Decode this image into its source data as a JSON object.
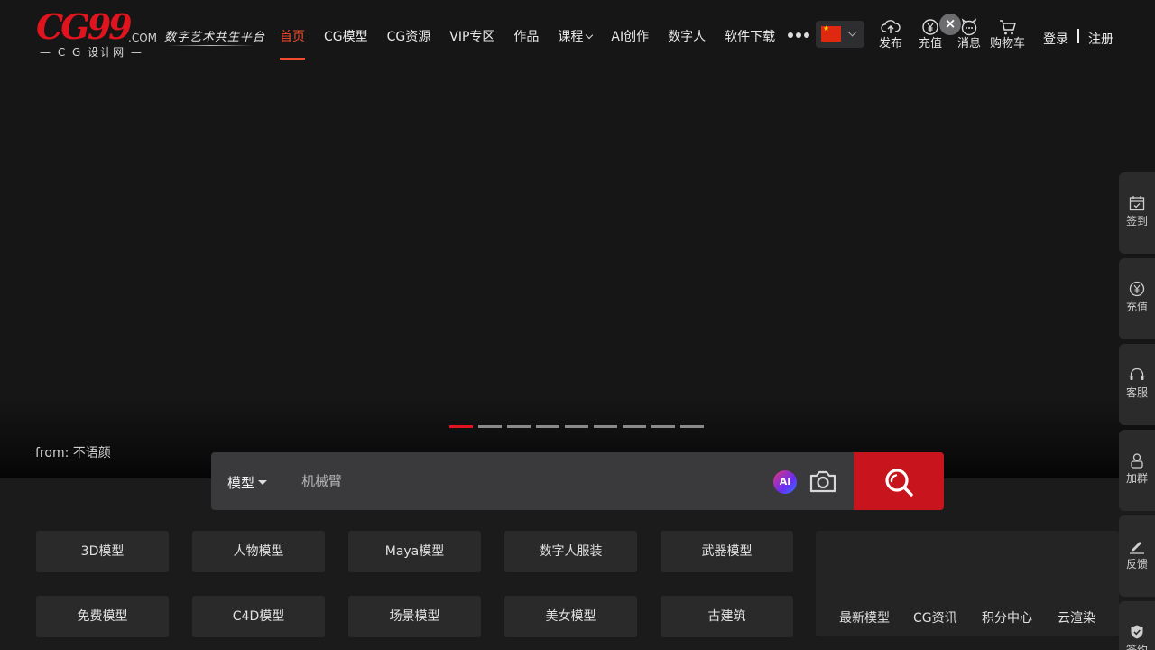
{
  "header": {
    "logo_main": "CG99",
    "logo_com": ".COM",
    "logo_sub": "— C G 设计网 —",
    "slogan": "数字艺术共生平台",
    "nav": [
      {
        "label": "首页",
        "active": true
      },
      {
        "label": "CG模型"
      },
      {
        "label": "CG资源"
      },
      {
        "label": "VIP专区"
      },
      {
        "label": "作品"
      },
      {
        "label": "课程"
      },
      {
        "label": "AI创作"
      },
      {
        "label": "数字人"
      },
      {
        "label": "软件下载"
      }
    ],
    "icons": {
      "publish": "发布",
      "recharge": "充值",
      "messages": "消息",
      "cart": "购物车"
    },
    "close_badge": "×",
    "login": "登录",
    "register": "注册"
  },
  "hero": {
    "credit": "from: 不语颜",
    "slide_count": 9,
    "active_slide": 1
  },
  "search": {
    "type_label": "模型",
    "placeholder": "机械臂",
    "ai_label": "AI"
  },
  "categories": {
    "row1": [
      "3D模型",
      "人物模型",
      "Maya模型",
      "数字人服装",
      "武器模型"
    ],
    "row2": [
      "免费模型",
      "C4D模型",
      "场景模型",
      "美女模型",
      "古建筑"
    ]
  },
  "quick_links": [
    "最新模型",
    "CG资讯",
    "积分中心",
    "云渲染"
  ],
  "side_tools": [
    "签到",
    "充值",
    "客服",
    "加群",
    "反馈",
    "签约"
  ],
  "colors": {
    "accent": "#f24a2e",
    "brand_red": "#e0141e",
    "search_button": "#c8141c"
  }
}
